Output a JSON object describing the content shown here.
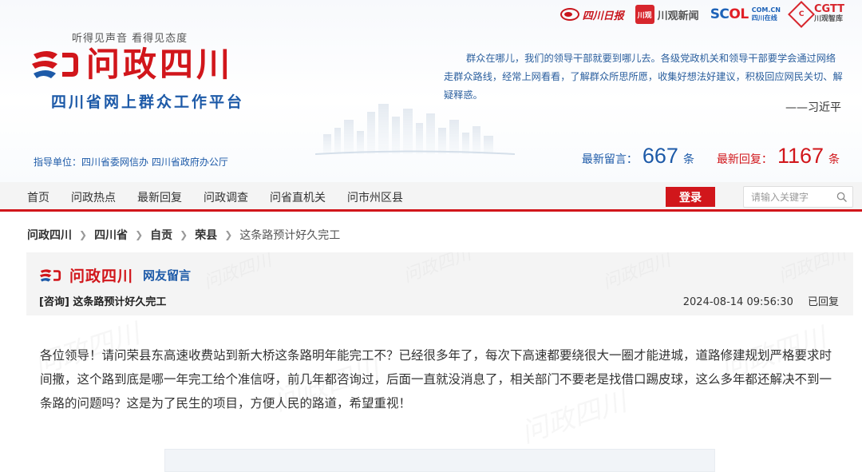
{
  "partners": {
    "sichuan_daily": "四川日报",
    "chuanguan_icon": "川观",
    "chuanguan_news": "川观新闻",
    "scol_brand": "SC",
    "scol_brand2": "OL",
    "scol_domain": "COM.CN",
    "scol_name": "四川在线",
    "cgtt_brand": "CGTT",
    "cgtt_name": "川观智库",
    "cgtt_icon": "C"
  },
  "header": {
    "slogan": "听得见声音  看得见态度",
    "title": "问政四川",
    "platform": "四川省网上群众工作平台",
    "guide": "指导单位：四川省委网信办 四川省政府办公厅",
    "quote": "群众在哪儿，我们的领导干部就要到哪儿去。各级党政机关和领导干部要学会通过网络走群众路线，经常上网看看，了解群众所思所愿，收集好想法好建议，积极回应网民关切、解疑释惑。",
    "quote_author": "——习近平"
  },
  "stats": {
    "new_messages_label": "最新留言：",
    "new_messages_count": "667",
    "new_replies_label": "最新回复：",
    "new_replies_count": "1167",
    "unit": "条"
  },
  "nav": {
    "items": [
      "首页",
      "问政热点",
      "最新回复",
      "问政调查",
      "问省直机关",
      "问市州区县"
    ],
    "login_label": "登录",
    "search_placeholder": "请输入关键字"
  },
  "breadcrumb": {
    "items": [
      "问政四川",
      "四川省",
      "自贡",
      "荣县"
    ],
    "current": "这条路预计好久完工"
  },
  "card": {
    "logo_title": "问政四川",
    "section": "网友留言",
    "subject": "[咨询] 这条路预计好久完工",
    "datetime": "2024-08-14 09:56:30",
    "status": "已回复"
  },
  "message": {
    "body": "各位领导！请问荣县东高速收费站到新大桥这条路明年能完工不？已经很多年了，每次下高速都要绕很大一圈才能进城，道路修建规划严格要求时间撒，这个路到底是哪一年完工给个准信呀，前几年都咨询过，后面一直就没消息了，相关部门不要老是找借口踢皮球，这么多年都还解决不到一条路的问题吗？这是为了民生的项目，方便人民的路道，希望重视！"
  },
  "colors": {
    "brand_red": "#d1161b",
    "brand_blue": "#1d5aa8"
  },
  "icons": [
    "logo-mark-icon",
    "search-icon",
    "chevron-right-icon",
    "skyline-icon"
  ]
}
